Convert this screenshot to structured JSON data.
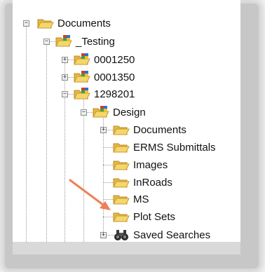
{
  "tree": {
    "root": {
      "label": "Documents",
      "expander": "−"
    },
    "testing": {
      "label": "_Testing",
      "expander": "−"
    },
    "n1": {
      "label": "0001250",
      "expander": "+"
    },
    "n2": {
      "label": "0001350",
      "expander": "+"
    },
    "n3": {
      "label": "1298201",
      "expander": "−"
    },
    "design": {
      "label": "Design",
      "expander": "−"
    },
    "children": [
      {
        "label": "Documents",
        "expander": "+"
      },
      {
        "label": "ERMS Submittals",
        "expander": ""
      },
      {
        "label": "Images",
        "expander": ""
      },
      {
        "label": "InRoads",
        "expander": ""
      },
      {
        "label": "MS",
        "expander": ""
      },
      {
        "label": "Plot Sets",
        "expander": ""
      }
    ],
    "saved": {
      "label": "Saved Searches",
      "expander": "+"
    }
  },
  "icons": {
    "folder": "folder-icon",
    "project_folder": "project-folder-icon",
    "saved_searches": "binoculars-icon"
  },
  "colors": {
    "folder": "#f2cf5a",
    "arrow": "#ef7f56"
  }
}
